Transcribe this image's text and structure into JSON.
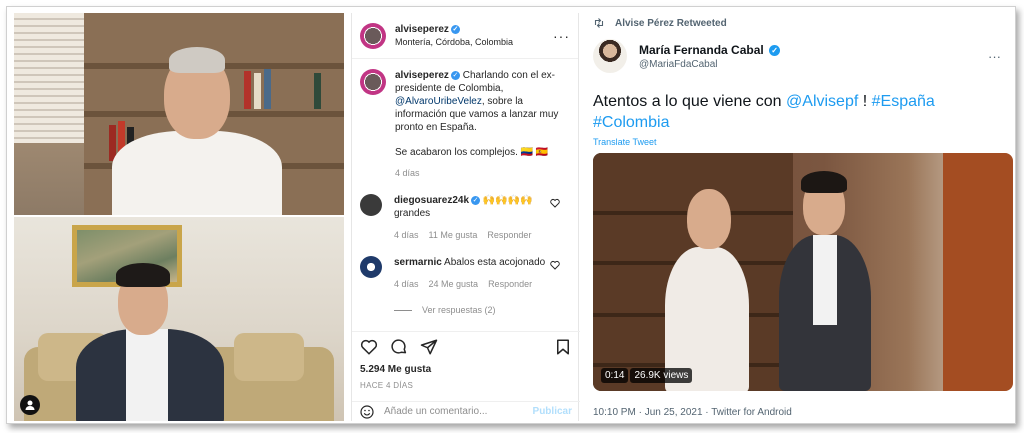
{
  "instagram": {
    "username": "alviseperez",
    "location": "Montería, Córdoba, Colombia",
    "more_label": "···",
    "caption": {
      "username": "alviseperez",
      "text_before": "Charlando con el ex-presidente de Colombia, ",
      "mention": "@AlvaroUribeVelez",
      "text_after": ", sobre la información que vamos a lanzar muy pronto en España.",
      "line2": "Se acabaron los complejos.",
      "emoji_suffix": "🇨🇴 🇪🇸",
      "time": "4 días"
    },
    "comments": [
      {
        "username": "diegosuarez24k",
        "text": "🙌🙌🙌🙌 grandes",
        "time": "4 días",
        "likes": "11 Me gusta",
        "reply": "Responder"
      },
      {
        "username": "sermarnic",
        "text": "Abalos esta acojonado",
        "time": "4 días",
        "likes": "24 Me gusta",
        "reply": "Responder"
      }
    ],
    "view_replies": "Ver respuestas (2)",
    "likes": "5.294 Me gusta",
    "posted": "HACE 4 DÍAS",
    "comment_placeholder": "Añade un comentario...",
    "post_button": "Publicar"
  },
  "twitter": {
    "retweet_label": "Alvise Pérez Retweeted",
    "name": "María Fernanda Cabal",
    "handle": "@MariaFdaCabal",
    "text_before": "Atentos a lo que viene con ",
    "mention": "@Alvisepf",
    "text_mid": " ! ",
    "hashtag1": "#España",
    "hashtag2": "#Colombia",
    "translate": "Translate Tweet",
    "video_time": "0:14",
    "video_views": "26.9K views",
    "footer": "10:10 PM · Jun 25, 2021 · Twitter for Android"
  },
  "colors": {
    "verified": "#3897f0",
    "twitter_blue": "#1d9bf0",
    "ig_link": "#00376b"
  }
}
